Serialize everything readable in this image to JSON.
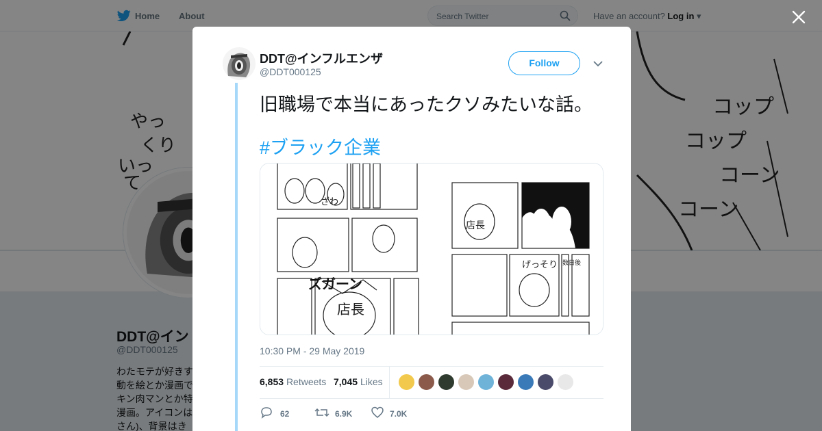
{
  "nav": {
    "home": "Home",
    "about": "About",
    "search_placeholder": "Search Twitter",
    "account_prompt": "Have an account?",
    "login": "Log in"
  },
  "profile_bg": {
    "name": "DDT@イン",
    "handle": "@DDT000125",
    "bio_lines": [
      "わたモテが好きす",
      "動を絵とか漫画で",
      "キン肉マンとか特",
      "漫画。アイコンは",
      "さん)、背景はき"
    ],
    "cover_text_left": [
      "やっ",
      "くり",
      "いっ",
      "て"
    ],
    "cover_text_right": [
      "コップ",
      "コップ",
      "コーン",
      "コーン"
    ]
  },
  "tweet": {
    "author_name": "DDT@インフルエンザ",
    "author_handle": "@DDT000125",
    "follow_label": "Follow",
    "text": "旧職場で本当にあったクソみたいな話。",
    "hashtag": "#ブラック企業",
    "timestamp": "10:30 PM - 29 May 2019",
    "retweets_count": "6,853",
    "retweets_label": "Retweets",
    "likes_count": "7,045",
    "likes_label": "Likes",
    "reply_count": "62",
    "retweet_action_count": "6.9K",
    "like_action_count": "7.0K",
    "manga_sfx": {
      "zuga": "ズガーン",
      "tencho": "店長",
      "zawa": "ざわ",
      "gessori": "げっそり",
      "days_later": "数日後"
    }
  },
  "colors": {
    "twitter_blue": "#1da1f2",
    "thread_line": "#a5d8f9",
    "overlay": "rgba(0,0,0,0.48)",
    "liker_avatars": [
      "#f2c94c",
      "#8b5a4a",
      "#2f3b2f",
      "#d8c8b8",
      "#6fb3d9",
      "#5a2a3a",
      "#3a7ab8",
      "#4a4a6a",
      "#e8e8e8"
    ]
  }
}
